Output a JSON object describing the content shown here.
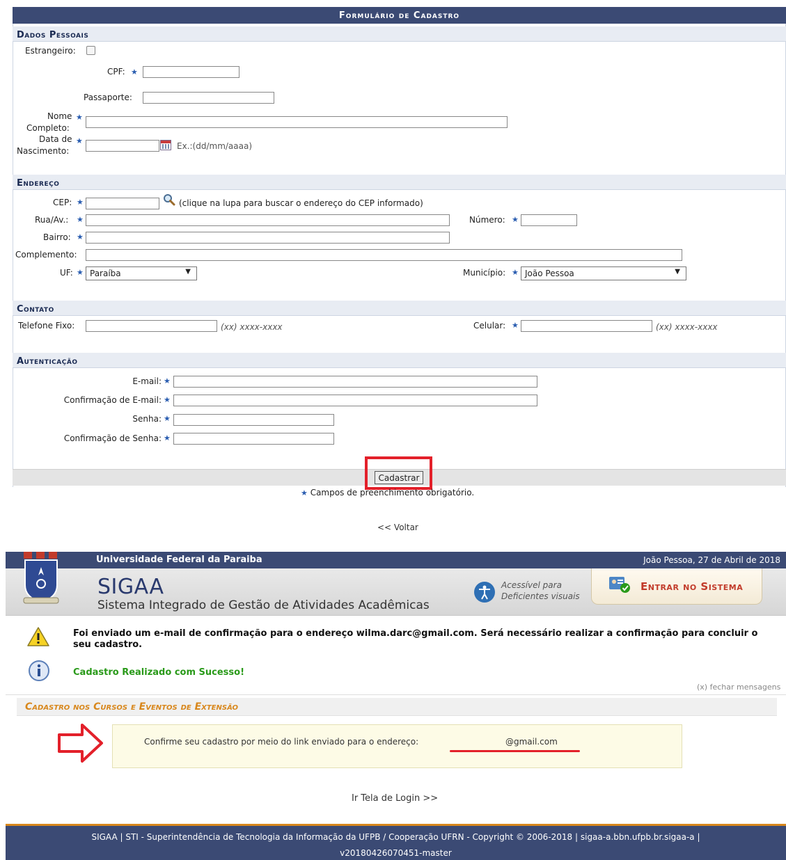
{
  "form": {
    "title": "Formulário de Cadastro",
    "sections": {
      "personal": "Dados Pessoais",
      "address": "Endereço",
      "contact": "Contato",
      "auth": "Autenticação"
    },
    "labels": {
      "estrangeiro": "Estrangeiro:",
      "cpf": "CPF:",
      "passaporte": "Passaporte:",
      "nome_l1": "Nome",
      "nome_l2": "Completo:",
      "data_l1": "Data de",
      "data_l2": "Nascimento:",
      "data_hint": "Ex.:(dd/mm/aaaa)",
      "cep": "CEP:",
      "cep_hint": "(clique na lupa para buscar o endereço do CEP informado)",
      "rua": "Rua/Av.:",
      "numero": "Número:",
      "bairro": "Bairro:",
      "complemento": "Complemento:",
      "uf": "UF:",
      "municipio": "Município:",
      "telefone": "Telefone Fixo:",
      "celular": "Celular:",
      "phone_hint": "(xx) xxxx-xxxx",
      "email": "E-mail:",
      "email_confirm": "Confirmação de E-mail:",
      "senha": "Senha:",
      "senha_confirm": "Confirmação de Senha:"
    },
    "values": {
      "uf": "Paraíba",
      "municipio": "João Pessoa"
    },
    "submit_label": "Cadastrar",
    "required_note": "Campos de preenchimento obrigatório.",
    "back_link": "<< Voltar",
    "required_marker": "★"
  },
  "sigaa": {
    "university": "Universidade Federal da Paraiba",
    "date": "João Pessoa, 27 de Abril de 2018",
    "logo_title": "SIGAA",
    "logo_subtitle": "Sistema Integrado de Gestão de Atividades Acadêmicas",
    "accessibility_l1": "Acessível para",
    "accessibility_l2": "Deficientes visuais",
    "login_button": "Entrar no Sistema",
    "messages": {
      "warning": "Foi enviado um e-mail de confirmação para o endereço wilma.darc@gmail.com. Será necessário realizar a confirmação para concluir o seu cadastro.",
      "success": "Cadastro Realizado com Sucesso!",
      "close": "(x) fechar mensagens"
    },
    "section_title": "Cadastro nos Cursos e Eventos de Extensão",
    "confirm_text": "Confirme seu cadastro por meio do link enviado para o endereço:",
    "email_suffix": "@gmail.com",
    "login_link": "Ir Tela de Login >>",
    "footer_l1": "SIGAA | STI - Superintendência de Tecnologia da Informação da UFPB / Cooperação UFRN - Copyright © 2006-2018 | sigaa-a.bbn.ufpb.br.sigaa-a |",
    "footer_l2": "v20180426070451-master"
  },
  "colors": {
    "header_blue": "#3b4a74",
    "section_bg": "#e8ecf3",
    "highlight_red": "#e3202a",
    "success_green": "#2a9a1a",
    "orange": "#d8871c"
  }
}
